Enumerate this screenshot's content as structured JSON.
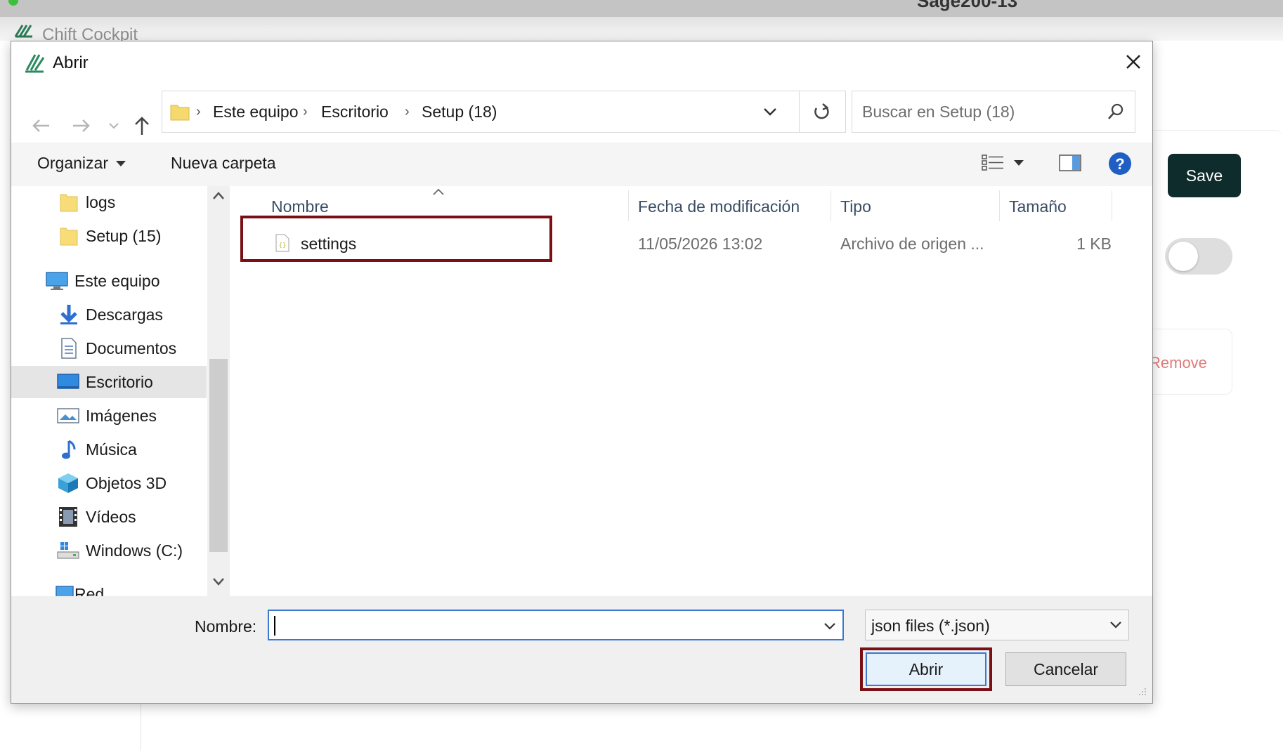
{
  "background_app": {
    "title": "Chift Cockpit",
    "window_title": "Sage200-13",
    "save_label": "Save",
    "remove_label": "Remove",
    "brand_color": "#0f2c2c"
  },
  "dialog": {
    "title": "Abrir",
    "breadcrumb": [
      "Este equipo",
      "Escritorio",
      "Setup (18)"
    ],
    "search_placeholder": "Buscar en Setup (18)",
    "toolbar": {
      "organize": "Organizar",
      "new_folder": "Nueva carpeta"
    },
    "nav_items": [
      {
        "label": "logs",
        "icon": "folder-icon"
      },
      {
        "label": "Setup (15)",
        "icon": "folder-icon"
      },
      {
        "label": "Este equipo",
        "icon": "computer-icon"
      },
      {
        "label": "Descargas",
        "icon": "download-icon"
      },
      {
        "label": "Documentos",
        "icon": "documents-icon"
      },
      {
        "label": "Escritorio",
        "icon": "desktop-icon",
        "selected": true
      },
      {
        "label": "Imágenes",
        "icon": "pictures-icon"
      },
      {
        "label": "Música",
        "icon": "music-icon"
      },
      {
        "label": "Objetos 3D",
        "icon": "objects-3d-icon"
      },
      {
        "label": "Vídeos",
        "icon": "videos-icon"
      },
      {
        "label": "Windows (C:)",
        "icon": "drive-icon"
      },
      {
        "label": "Red",
        "icon": "network-icon"
      }
    ],
    "columns": {
      "name": "Nombre",
      "modified": "Fecha de modificación",
      "type": "Tipo",
      "size": "Tamaño"
    },
    "files": [
      {
        "name": "settings",
        "modified": "11/05/2026 13:02",
        "type": "Archivo de origen ...",
        "size": "1 KB",
        "icon": "json-file-icon"
      }
    ],
    "filename_label": "Nombre:",
    "filename_value": "",
    "filter_value": "json files (*.json)",
    "open_label": "Abrir",
    "cancel_label": "Cancelar",
    "highlight_color": "#7a0f14",
    "accent_color": "#3a78d4"
  }
}
